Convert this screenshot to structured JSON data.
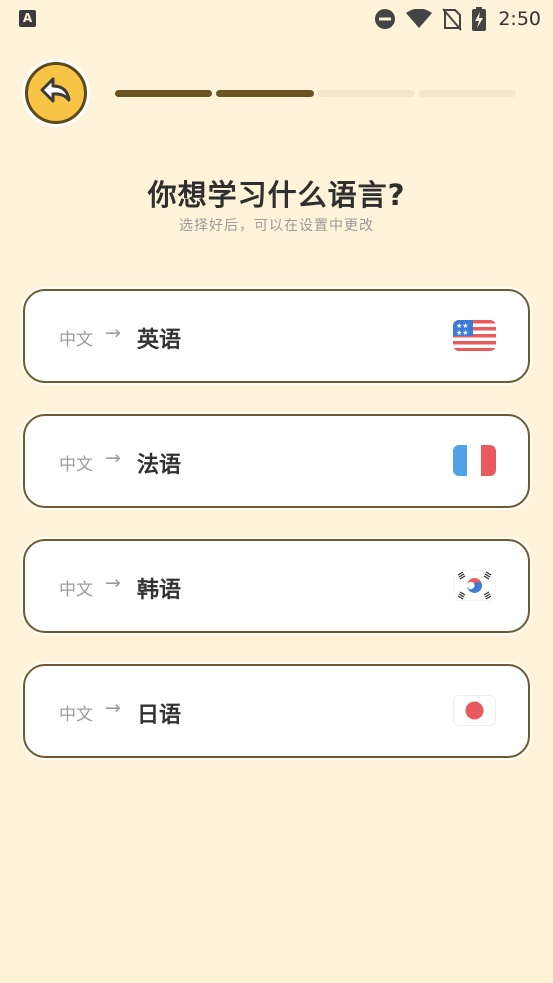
{
  "status_bar": {
    "app_icon_letter": "A",
    "time": "2:50"
  },
  "header": {
    "progress": {
      "segments_total": 4,
      "segments_done": 2
    }
  },
  "title": "你想学习什么语言?",
  "subtitle": "选择好后，可以在设置中更改",
  "languages": [
    {
      "from": "中文",
      "arrow": "→",
      "to": "英语",
      "flag_icon": "us-flag-icon"
    },
    {
      "from": "中文",
      "arrow": "→",
      "to": "法语",
      "flag_icon": "france-flag-icon"
    },
    {
      "from": "中文",
      "arrow": "→",
      "to": "韩语",
      "flag_icon": "korea-flag-icon"
    },
    {
      "from": "中文",
      "arrow": "→",
      "to": "日语",
      "flag_icon": "japan-flag-icon"
    }
  ],
  "colors": {
    "background": "#FFF4D9",
    "accent_yellow": "#F7C445",
    "progress_done": "#6B5424",
    "progress_todo": "#F2E7C9",
    "card_border": "#6F5B33"
  }
}
